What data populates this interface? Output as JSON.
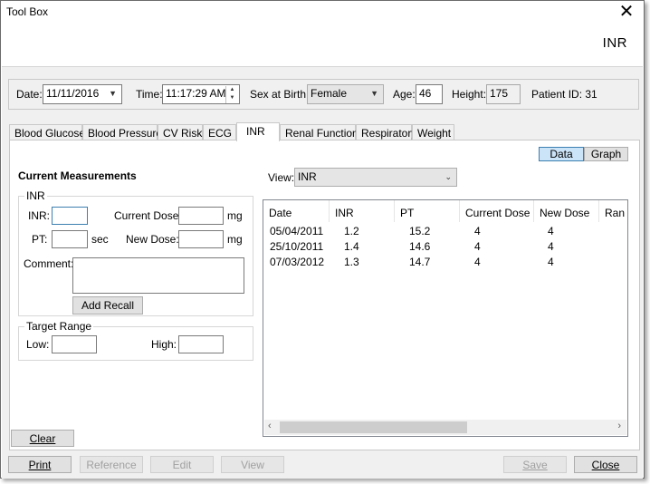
{
  "window": {
    "title": "Tool Box",
    "header": "INR"
  },
  "toolbar": {
    "date_label": "Date:",
    "date_value": "11/11/2016",
    "time_label": "Time:",
    "time_value": "11:17:29 AM",
    "sex_label": "Sex at Birth:",
    "sex_value": "Female",
    "age_label": "Age:",
    "age_value": "46",
    "height_label": "Height:",
    "height_value": "175",
    "patient_id": "Patient ID: 31"
  },
  "tabs": [
    {
      "label": "Blood Glucose"
    },
    {
      "label": "Blood Pressure"
    },
    {
      "label": "CV Risk"
    },
    {
      "label": "ECG"
    },
    {
      "label": "INR",
      "active": true
    },
    {
      "label": "Renal Function"
    },
    {
      "label": "Respiratory"
    },
    {
      "label": "Weight"
    }
  ],
  "view_toggle": {
    "data": "Data",
    "graph": "Graph",
    "selected": "Data"
  },
  "measurements": {
    "title": "Current Measurements",
    "inr_group": "INR",
    "inr_label": "INR:",
    "current_dose_label": "Current Dose:",
    "mg1": "mg",
    "pt_label": "PT:",
    "sec": "sec",
    "new_dose_label": "New Dose:",
    "mg2": "mg",
    "comment_label": "Comment:",
    "add_recall": "Add Recall",
    "target_group": "Target Range",
    "low_label": "Low:",
    "high_label": "High:"
  },
  "view": {
    "label": "View:",
    "value": "INR"
  },
  "table": {
    "columns": [
      "Date",
      "INR",
      "PT",
      "Current Dose",
      "New Dose",
      "Ran"
    ],
    "rows": [
      [
        "05/04/2011",
        "1.2",
        "15.2",
        "4",
        "4"
      ],
      [
        "25/10/2011",
        "1.4",
        "14.6",
        "4",
        "4"
      ],
      [
        "07/03/2012",
        "1.3",
        "14.7",
        "4",
        "4"
      ]
    ]
  },
  "buttons": {
    "clear": "Clear",
    "print": "Print",
    "reference": "Reference",
    "edit": "Edit",
    "view": "View",
    "save": "Save",
    "close": "Close"
  },
  "icons": {
    "close": "close-icon",
    "dropdown": "chevron-down-icon",
    "spinner": "spinner-icon"
  },
  "colors": {
    "accent": "#3c7fb1",
    "selected_bg": "#cce4f7",
    "panel_bg": "#f0f0f0"
  }
}
